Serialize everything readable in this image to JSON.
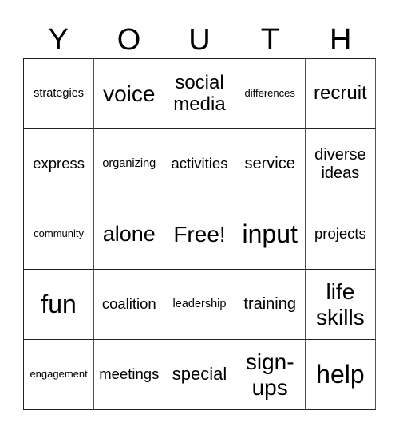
{
  "title_letters": [
    "Y",
    "O",
    "U",
    "T",
    "H"
  ],
  "cells": [
    [
      "strategies",
      "voice",
      "social media",
      "differences",
      "recruit"
    ],
    [
      "express",
      "organizing",
      "activities",
      "service",
      "diverse ideas"
    ],
    [
      "community",
      "alone",
      "Free!",
      "input",
      "projects"
    ],
    [
      "fun",
      "coalition",
      "leadership",
      "training",
      "life skills"
    ],
    [
      "engagement",
      "meetings",
      "special",
      "sign-ups",
      "help"
    ]
  ]
}
